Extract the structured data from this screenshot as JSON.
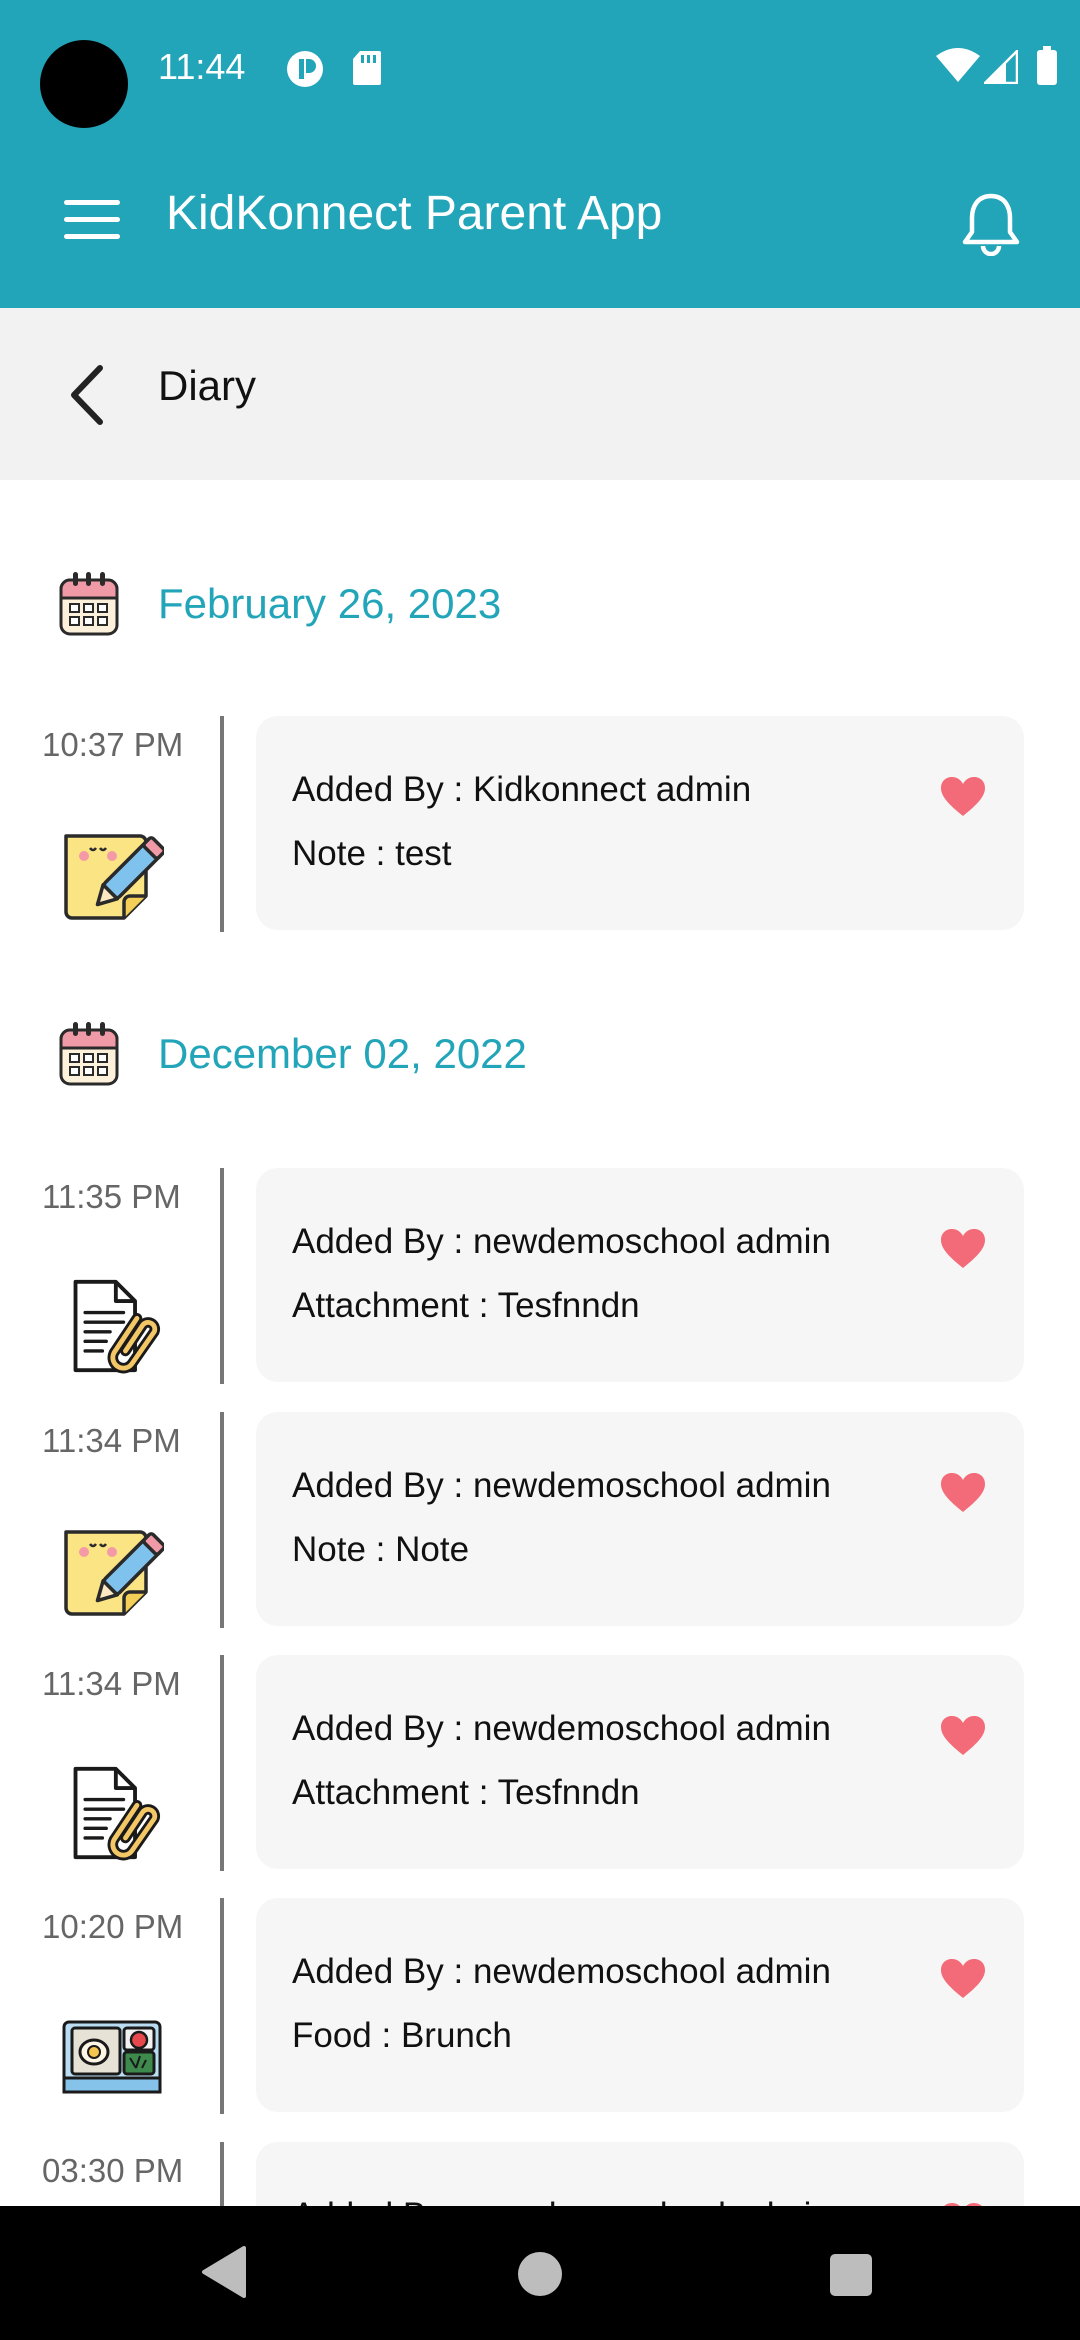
{
  "status_bar": {
    "time": "11:44"
  },
  "app_bar": {
    "title": "KidKonnect Parent App"
  },
  "sub_header": {
    "title": "Diary"
  },
  "colors": {
    "accent": "#23a5b9",
    "heart": "#f36b78",
    "card_bg": "#f6f6f6"
  },
  "dates": [
    {
      "label": "February 26, 2023"
    },
    {
      "label": "December 02, 2022"
    }
  ],
  "entries": [
    {
      "time": "10:37 PM",
      "line1": "Added By : Kidkonnect admin",
      "line2": "Note : test",
      "icon": "note-pencil-icon"
    },
    {
      "time": "11:35 PM",
      "line1": "Added By : newdemoschool admin",
      "line2": "Attachment : Tesfnndn",
      "icon": "attachment-document-icon"
    },
    {
      "time": "11:34 PM",
      "line1": "Added By : newdemoschool admin",
      "line2": "Note : Note",
      "icon": "note-pencil-icon"
    },
    {
      "time": "11:34 PM",
      "line1": "Added By : newdemoschool admin",
      "line2": "Attachment : Tesfnndn",
      "icon": "attachment-document-icon"
    },
    {
      "time": "10:20 PM",
      "line1": "Added By : newdemoschool admin",
      "line2": "Food : Brunch",
      "icon": "lunchbox-icon"
    },
    {
      "time": "03:30 PM",
      "line1": "Added By : newdemoschool admin",
      "line2": "",
      "icon": "note-pencil-icon"
    }
  ]
}
